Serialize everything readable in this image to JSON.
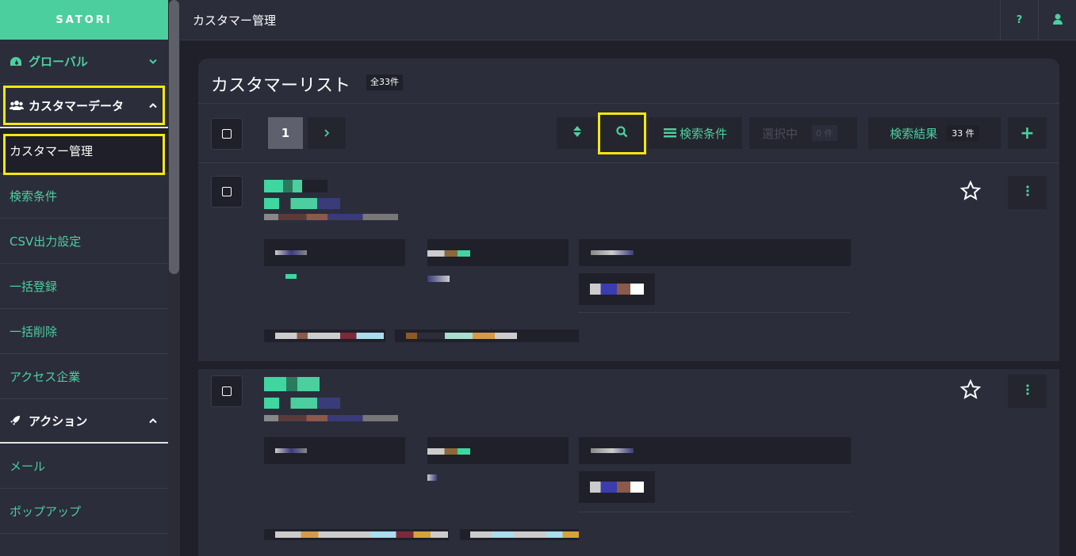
{
  "brand": "SATORI",
  "sidebar": {
    "groups": [
      {
        "label": "グローバル",
        "icon": "dashboard-icon",
        "expanded": false
      },
      {
        "label": "カスタマーデータ",
        "icon": "users-icon",
        "expanded": true
      },
      {
        "label": "アクション",
        "icon": "rocket-icon",
        "expanded": true
      }
    ],
    "customer_items": [
      "カスタマー管理",
      "検索条件",
      "CSV出力設定",
      "一括登録",
      "一括削除",
      "アクセス企業"
    ],
    "action_items": [
      "メール",
      "ポップアップ"
    ]
  },
  "header": {
    "title": "カスタマー管理",
    "help_label": "?",
    "user_icon": "user-icon"
  },
  "list": {
    "title": "カスタマーリスト",
    "total_badge": "全33件",
    "page_number": "1",
    "next_label": "›",
    "search_conditions_label": "検索条件",
    "selected_label": "選択中",
    "selected_count": "0 件",
    "search_results_label": "検索結果",
    "search_results_count": "33 件",
    "add_label": "+"
  },
  "colors": {
    "accent": "#4ccf9e",
    "highlight": "#f5e70f",
    "sidebar_bg": "#2b2d3b",
    "page_bg": "#1f2029"
  }
}
